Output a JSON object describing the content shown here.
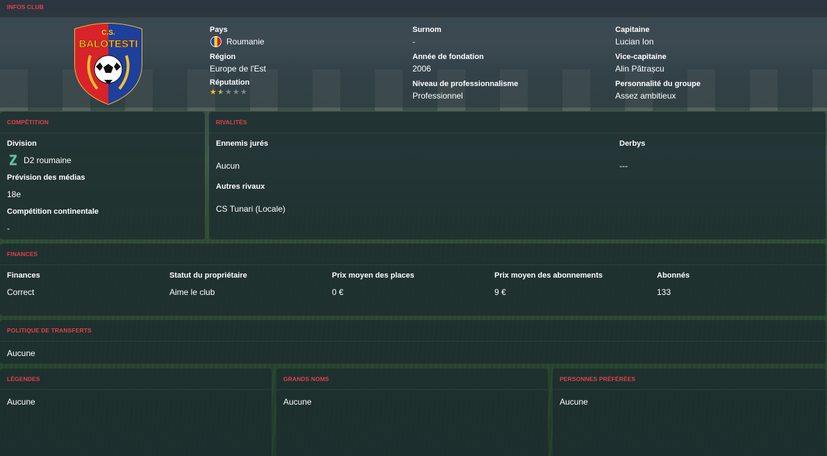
{
  "club": {
    "section_title": "INFOS CLUB",
    "crest_text_top": "C.S.",
    "crest_text_name": "BALOTESTI",
    "country_label": "Pays",
    "country_value": "Roumanie",
    "region_label": "Région",
    "region_value": "Europe de l'Est",
    "reputation_label": "Réputation",
    "reputation_stars": 1.5,
    "reputation_max": 5,
    "nickname_label": "Surnom",
    "nickname_value": "-",
    "founded_label": "Année de fondation",
    "founded_value": "2006",
    "professionalism_label": "Niveau de professionnalisme",
    "professionalism_value": "Professionnel",
    "captain_label": "Capitaine",
    "captain_value": "Lucian Ion",
    "vice_captain_label": "Vice-capitaine",
    "vice_captain_value": "Alin Pătrașcu",
    "group_personality_label": "Personnalité du groupe",
    "group_personality_value": "Assez ambitieux"
  },
  "competition": {
    "section_title": "COMPÉTITION",
    "division_label": "Division",
    "division_value": "D2 roumaine",
    "media_label": "Prévision des médias",
    "media_value": "18e",
    "continental_label": "Compétition continentale",
    "continental_value": "-"
  },
  "rivalries": {
    "section_title": "RIVALITÉS",
    "sworn_label": "Ennemis jurés",
    "sworn_value": "Aucun",
    "other_label": "Autres rivaux",
    "other_value": "CS Tunari (Locale)",
    "derbies_label": "Derbys",
    "derbies_value": "---"
  },
  "finances": {
    "section_title": "FINANCES",
    "finances_label": "Finances",
    "finances_value": "Correct",
    "owner_label": "Statut du propriétaire",
    "owner_value": "Aime le club",
    "ticket_label": "Prix moyen des places",
    "ticket_value": "0 €",
    "season_ticket_label": "Prix moyen des abonnements",
    "season_ticket_value": "9 €",
    "subscribers_label": "Abonnés",
    "subscribers_value": "133"
  },
  "transfers": {
    "section_title": "POLITIQUE DE TRANSFERTS",
    "value": "Aucune"
  },
  "legends": {
    "section_title": "LÉGENDES",
    "value": "Aucune"
  },
  "big_names": {
    "section_title": "GRANDS NOMS",
    "value": "Aucune"
  },
  "favored_people": {
    "section_title": "PERSONNES PRÉFÉRÉES",
    "value": "Aucune"
  },
  "colors": {
    "section_title": "#e0404c",
    "crest_red": "#d8232a",
    "crest_blue": "#1e3f9a",
    "star_gold": "#e9c334"
  }
}
